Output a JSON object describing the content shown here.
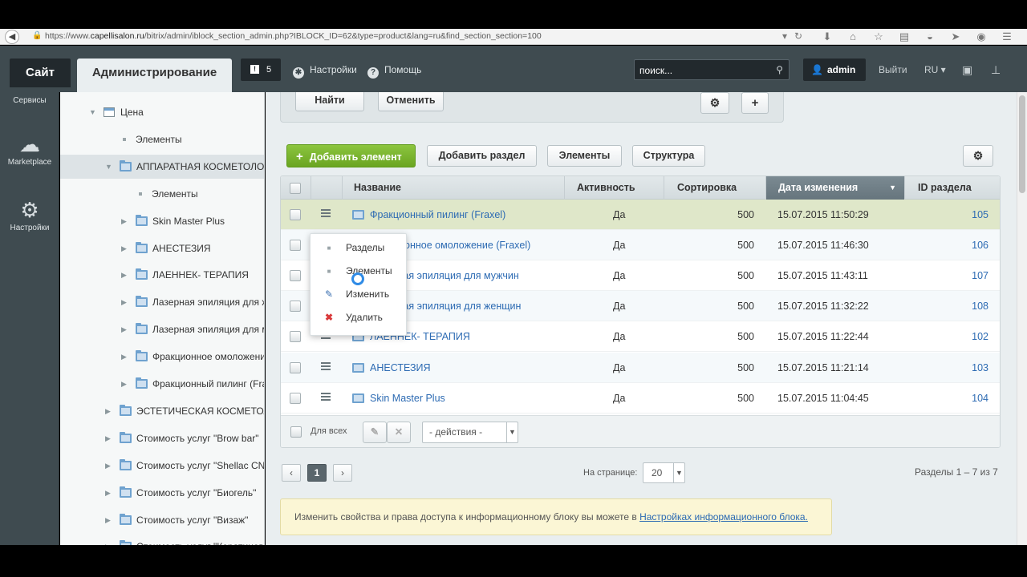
{
  "browser": {
    "url_prefix": "https://www.",
    "url_host": "capellisalon.ru",
    "url_rest": "/bitrix/admin/iblock_section_admin.php?IBLOCK_ID=62&type=product&lang=ru&find_section_section=100"
  },
  "header": {
    "tab_site": "Сайт",
    "tab_admin": "Администрирование",
    "notifications_count": "5",
    "settings_label": "Настройки",
    "help_label": "Помощь",
    "search_placeholder": "поиск...",
    "user_name": "admin",
    "logout_label": "Выйти",
    "lang_label": "RU"
  },
  "rail": {
    "services": "Сервисы",
    "marketplace": "Marketplace",
    "settings": "Настройки"
  },
  "tree": {
    "items": [
      {
        "label": "Цена",
        "kind": "calendar",
        "expanded": true
      },
      {
        "label": "Элементы",
        "kind": "dot"
      },
      {
        "label": "АППАРАТНАЯ КОСМЕТОЛОГИЯ",
        "kind": "folder",
        "expanded": true,
        "selected": true
      },
      {
        "label": "Элементы",
        "kind": "dot"
      },
      {
        "label": "Skin Master Plus",
        "kind": "folder"
      },
      {
        "label": "АНЕСТЕЗИЯ",
        "kind": "folder"
      },
      {
        "label": "ЛАЕННЕК- ТЕРАПИЯ",
        "kind": "folder"
      },
      {
        "label": "Лазерная эпиляция для женщин",
        "kind": "folder"
      },
      {
        "label": "Лазерная эпиляция для мужчин",
        "kind": "folder"
      },
      {
        "label": "Фракционное омоложение (Fraxel)",
        "kind": "folder"
      },
      {
        "label": "Фракционный пилинг (Fraxel)",
        "kind": "folder"
      },
      {
        "label": "ЭСТЕТИЧЕСКАЯ КОСМЕТОЛОГИЯ",
        "kind": "folder"
      },
      {
        "label": "Стоимость услуг \"Brow bar\"",
        "kind": "folder"
      },
      {
        "label": "Стоимость услуг \"Shellac CND\"",
        "kind": "folder"
      },
      {
        "label": "Стоимость услуг \"Биогель\"",
        "kind": "folder"
      },
      {
        "label": "Стоимость услуг \"Визаж\"",
        "kind": "folder"
      },
      {
        "label": "Стоимость услуг \"Кератиновое\"",
        "kind": "folder"
      }
    ]
  },
  "filter": {
    "find_label": "Найти",
    "cancel_label": "Отменить"
  },
  "toolbar": {
    "add_element": "Добавить элемент",
    "add_section": "Добавить раздел",
    "elements": "Элементы",
    "structure": "Структура"
  },
  "grid": {
    "columns": [
      "Название",
      "Активность",
      "Сортировка",
      "Дата изменения",
      "ID раздела"
    ],
    "rows": [
      {
        "name": "Фракционный пилинг (Fraxel)",
        "active": "Да",
        "sort": "500",
        "date": "15.07.2015 11:50:29",
        "id": "105"
      },
      {
        "name": "Фракционное омоложение (Fraxel)",
        "active": "Да",
        "sort": "500",
        "date": "15.07.2015 11:46:30",
        "id": "106"
      },
      {
        "name": "Лазерная эпиляция для мужчин",
        "active": "Да",
        "sort": "500",
        "date": "15.07.2015 11:43:11",
        "id": "107"
      },
      {
        "name": "Лазерная эпиляция для женщин",
        "active": "Да",
        "sort": "500",
        "date": "15.07.2015 11:32:22",
        "id": "108"
      },
      {
        "name": "ЛАЕННЕК- ТЕРАПИЯ",
        "active": "Да",
        "sort": "500",
        "date": "15.07.2015 11:22:44",
        "id": "102"
      },
      {
        "name": "АНЕСТЕЗИЯ",
        "active": "Да",
        "sort": "500",
        "date": "15.07.2015 11:21:14",
        "id": "103"
      },
      {
        "name": "Skin Master Plus",
        "active": "Да",
        "sort": "500",
        "date": "15.07.2015 11:04:45",
        "id": "104"
      }
    ],
    "footer": {
      "for_all": "Для всех",
      "actions": "- действия -"
    }
  },
  "context_menu": {
    "items": [
      "Разделы",
      "Элементы",
      "Изменить",
      "Удалить"
    ]
  },
  "pager": {
    "current_page": "1",
    "per_page_label": "На странице:",
    "per_page_value": "20",
    "summary": "Разделы 1 – 7 из 7"
  },
  "note": {
    "text": "Изменить свойства и права доступа к информационному блоку вы можете в ",
    "link": "Настройках информационного блока."
  },
  "colors": {
    "header_bg": "#3f4b50",
    "add_button": "#7ab630",
    "link": "#2d6bb3",
    "row_highlight": "#dfe7c9"
  }
}
